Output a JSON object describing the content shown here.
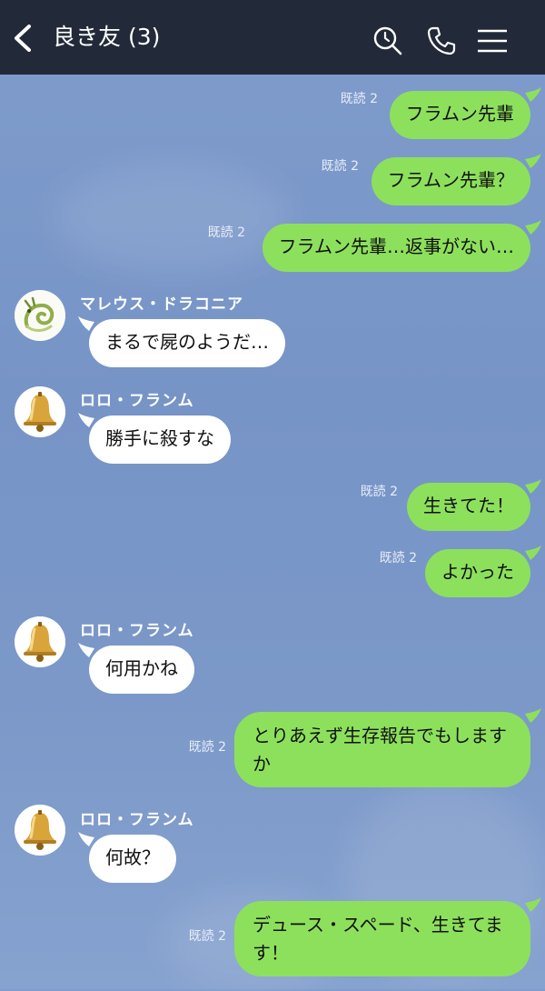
{
  "header": {
    "title": "良き友 (3)",
    "icons": [
      "back-icon",
      "search-icon",
      "phone-icon",
      "menu-icon"
    ]
  },
  "colors": {
    "header_bg": "#222a39",
    "my_bubble": "#8de05c",
    "their_bubble": "#ffffff",
    "chat_bg": "#7f9ccc"
  },
  "messages": [
    {
      "from": "me",
      "read": "既読 2",
      "text": "フラムン先輩"
    },
    {
      "from": "me",
      "read": "既読 2",
      "text": "フラムン先輩？"
    },
    {
      "from": "me",
      "read": "既読 2",
      "text": "フラムン先輩…返事がない…"
    },
    {
      "from": "them",
      "sender": "マレウス・ドラコニア",
      "avatar": "dragon-avatar",
      "text": "まるで屍のようだ…"
    },
    {
      "from": "them",
      "sender": "ロロ・フランム",
      "avatar": "bell-avatar",
      "text": "勝手に殺すな"
    },
    {
      "from": "me",
      "read": "既読 2",
      "text": "生きてた！"
    },
    {
      "from": "me",
      "read": "既読 2",
      "text": "よかった"
    },
    {
      "from": "them",
      "sender": "ロロ・フランム",
      "avatar": "bell-avatar",
      "text": "何用かね"
    },
    {
      "from": "me",
      "read": "既読 2",
      "text": "とりあえず生存報告でもしますか"
    },
    {
      "from": "them",
      "sender": "ロロ・フランム",
      "avatar": "bell-avatar",
      "text": "何故？"
    },
    {
      "from": "me",
      "read": "既読 2",
      "text": "デュース・スペード、生きてます！"
    }
  ]
}
